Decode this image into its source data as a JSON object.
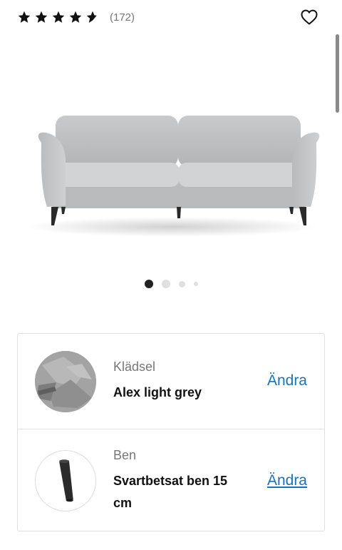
{
  "rating": {
    "stars": 4.5,
    "review_count": "(172)"
  },
  "icons": {
    "wishlist": "heart-outline-icon",
    "star": "star-icon"
  },
  "product": {
    "image_name": "sofa-image",
    "gallery_count": 4,
    "gallery_active": 1
  },
  "options": [
    {
      "label": "Klädsel",
      "value": "Alex light grey",
      "action": "Ändra",
      "thumb": "fabric-swatch"
    },
    {
      "label": "Ben",
      "value": "Svartbetsat ben 15 cm",
      "action": "Ändra",
      "thumb": "leg-swatch"
    }
  ],
  "colors": {
    "link": "#1a73b8",
    "active_dot": "#222222",
    "inactive_dot": "#e0e0e0"
  }
}
